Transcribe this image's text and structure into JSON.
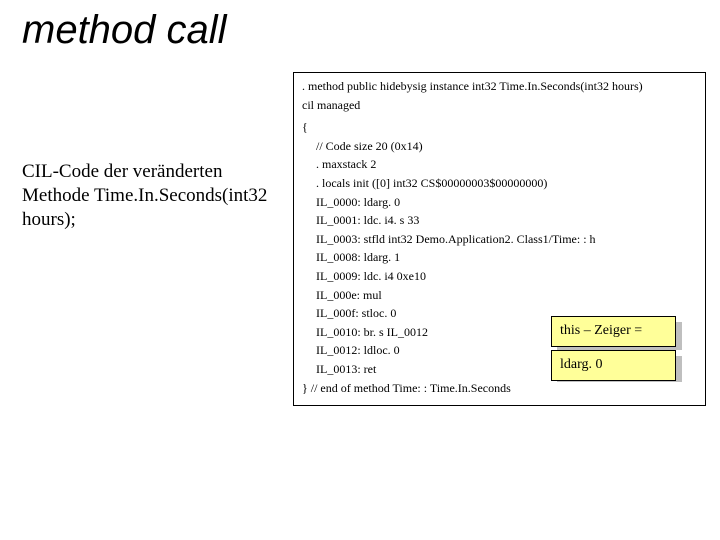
{
  "title": "method call",
  "left_text": "CIL-Code der veränderten Methode Time.In.Seconds(int32 hours);",
  "code": {
    "sig1": ". method public hidebysig instance int32  Time.In.Seconds(int32 hours)",
    "sig2": "cil managed",
    "open": "{",
    "l1": "// Code size       20 (0x14)",
    "l2": ". maxstack  2",
    "l3": ". locals init ([0] int32 CS$00000003$00000000)",
    "l4": "IL_0000:  ldarg. 0",
    "l5": "IL_0001:  ldc. i4. s   33",
    "l6": "IL_0003:  stfld      int32 Demo.Application2. Class1/Time: : h",
    "l7": "IL_0008:  ldarg. 1",
    "l8": "IL_0009:  ldc. i4     0xe10",
    "l9": "IL_000e:  mul",
    "l10": "IL_000f:  stloc. 0",
    "l11": "IL_0010:  br. s       IL_0012",
    "l12": "IL_0012:  ldloc. 0",
    "l13": "IL_0013:  ret",
    "close": "} // end of method Time: : Time.In.Seconds"
  },
  "callout1": "this – Zeiger =",
  "callout2": "ldarg. 0"
}
